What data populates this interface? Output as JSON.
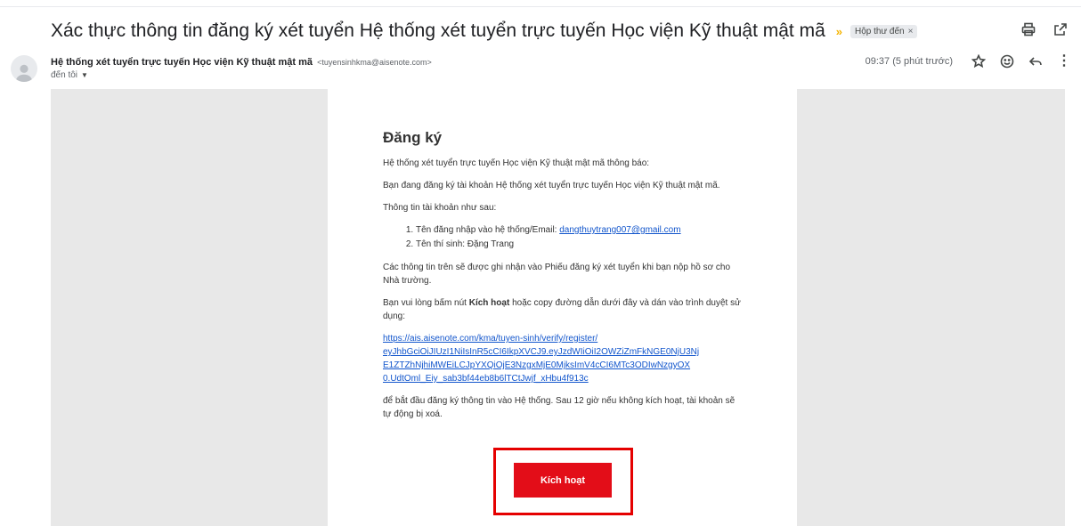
{
  "email": {
    "subject": "Xác thực thông tin đăng ký xét tuyển Hệ thống xét tuyển trực tuyến Học viện Kỹ thuật mật mã",
    "label_chip": "Hộp thư đến",
    "label_chip_close": "×",
    "importance_marker": "»",
    "sender_name": "Hệ thống xét tuyển trực tuyến Học viện Kỹ thuật mật mã",
    "sender_email": "<tuyensinhkma@aisenote.com>",
    "to_label": "đến tôi",
    "timestamp": "09:37 (5 phút trước)",
    "icons": [
      "print-icon",
      "open-in-new-window-icon",
      "star-icon",
      "emoji-icon",
      "reply-icon",
      "more-icon",
      "avatar-icon"
    ]
  },
  "card": {
    "title": "Đăng ký",
    "p1": "Hệ thống xét tuyển trực tuyến Học viện Kỹ thuật mật mã thông báo:",
    "p2": "Bạn đang đăng ký tài khoản Hệ thống xét tuyển trực tuyến Học viện Kỹ thuật mật mã.",
    "p3": "Thông tin tài khoản như sau:",
    "list": {
      "item1_label": "Tên đăng nhập vào hệ thống/Email: ",
      "item1_link": "dangthuytrang007@gmail.com",
      "item2": "Tên thí sinh: Đặng Trang"
    },
    "p4": "Các thông tin trên sẽ được ghi nhận vào Phiếu đăng ký xét tuyển khi bạn nộp hồ sơ cho Nhà trường.",
    "p5_before": "Bạn vui lòng bấm nút ",
    "p5_bold": "Kích hoạt",
    "p5_after": " hoặc copy đường dẫn dưới đây và dán vào trình duyệt sử dụng:",
    "url_lines": [
      "https://ais.aisenote.com/kma/tuyen-sinh/verify/register/",
      "eyJhbGciOiJIUzI1NiIsInR5cCI6IkpXVCJ9.eyJzdWIiOiI2OWZiZmFkNGE0NjU3Nj",
      "E1ZTZhNjhiMWEiLCJpYXQiOjE3NzgxMjE0MjksImV4cCI6MTc3ODIwNzgyOX",
      "0.UdtOml_Eiy_sab3bf44eb8b6lTCtJwjf_xHbu4f913c"
    ],
    "p6": "để bắt đầu đăng ký thông tin vào Hệ thống. Sau 12 giờ nếu không kích hoạt, tài khoản sẽ tự động bị xoá.",
    "button_label": "Kích hoạt"
  },
  "colors": {
    "button_red": "#e30d18",
    "highlight_border": "#e50000",
    "link_blue": "#1155cc",
    "canvas_gray": "#e8e8e8",
    "importance_yellow": "#f4b400"
  }
}
